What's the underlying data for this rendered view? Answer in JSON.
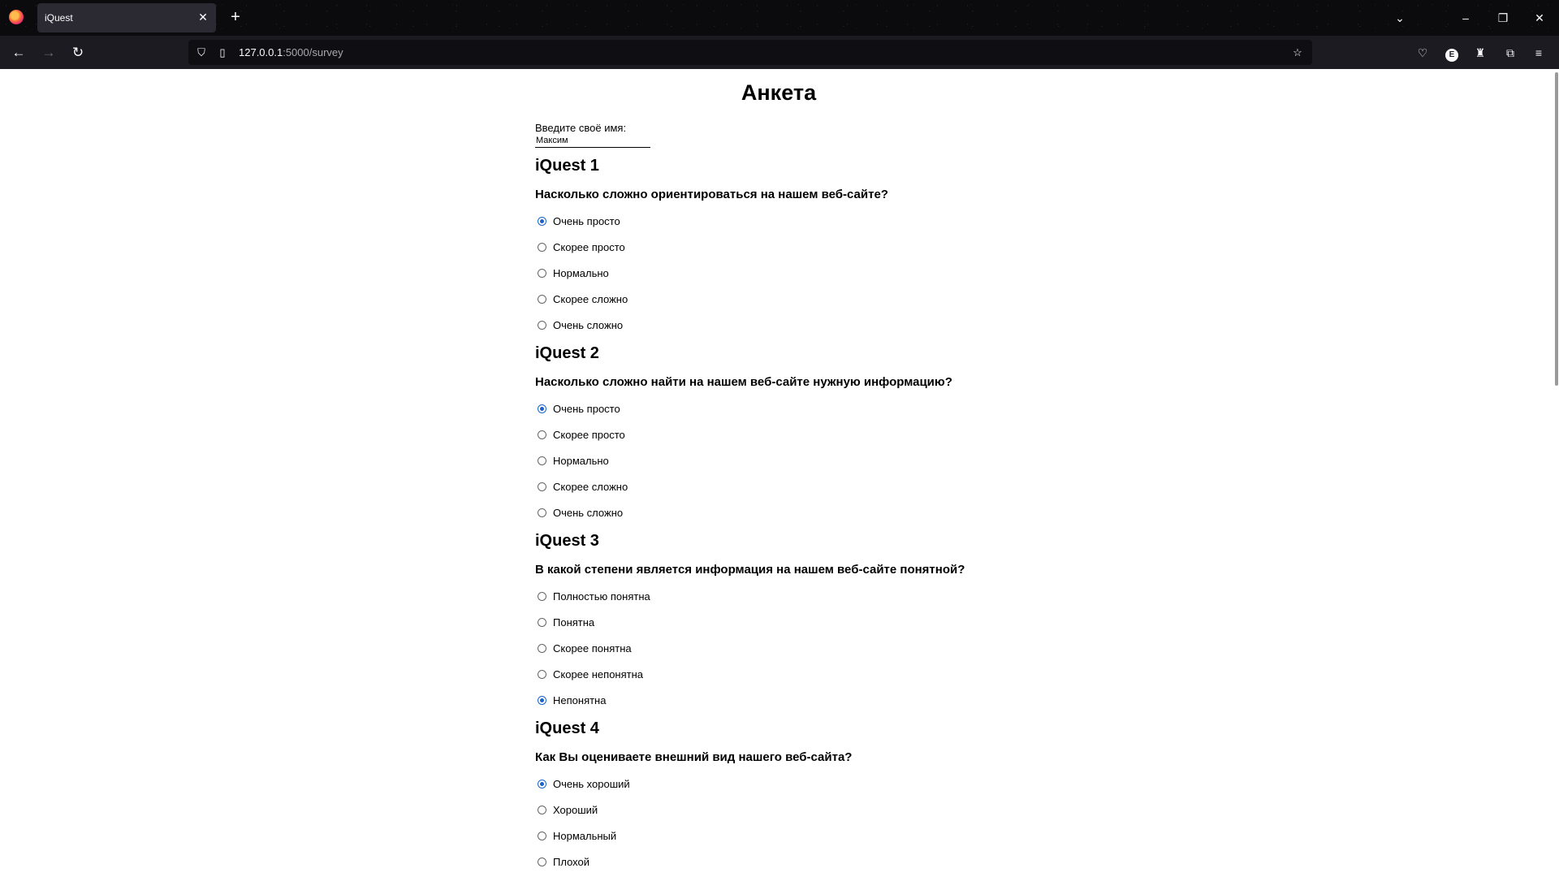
{
  "browser": {
    "tab_title": "iQuest",
    "tab_close": "✕",
    "new_tab": "+",
    "url_host": "127.0.0.1",
    "url_rest": ":5000/survey",
    "profile_letter": "E"
  },
  "page": {
    "title": "Анкета",
    "name_label": "Введите своё имя:",
    "name_value": "Максим"
  },
  "questions": [
    {
      "heading": "iQuest 1",
      "text": "Насколько сложно ориентироваться на нашем веб-сайте?",
      "options": [
        "Очень просто",
        "Скорее просто",
        "Нормально",
        "Скорее сложно",
        "Очень сложно"
      ],
      "selected": 0
    },
    {
      "heading": "iQuest 2",
      "text": "Насколько сложно найти на нашем веб-сайте нужную информацию?",
      "options": [
        "Очень просто",
        "Скорее просто",
        "Нормально",
        "Скорее сложно",
        "Очень сложно"
      ],
      "selected": 0
    },
    {
      "heading": "iQuest 3",
      "text": "В какой степени является информация на нашем веб-сайте понятной?",
      "options": [
        "Полностью понятна",
        "Понятна",
        "Скорее понятна",
        "Скорее непонятна",
        "Непонятна"
      ],
      "selected": 4
    },
    {
      "heading": "iQuest 4",
      "text": "Как Вы оцениваете внешний вид нашего веб-сайта?",
      "options": [
        "Очень хороший",
        "Хороший",
        "Нормальный",
        "Плохой"
      ],
      "selected": 0
    }
  ]
}
